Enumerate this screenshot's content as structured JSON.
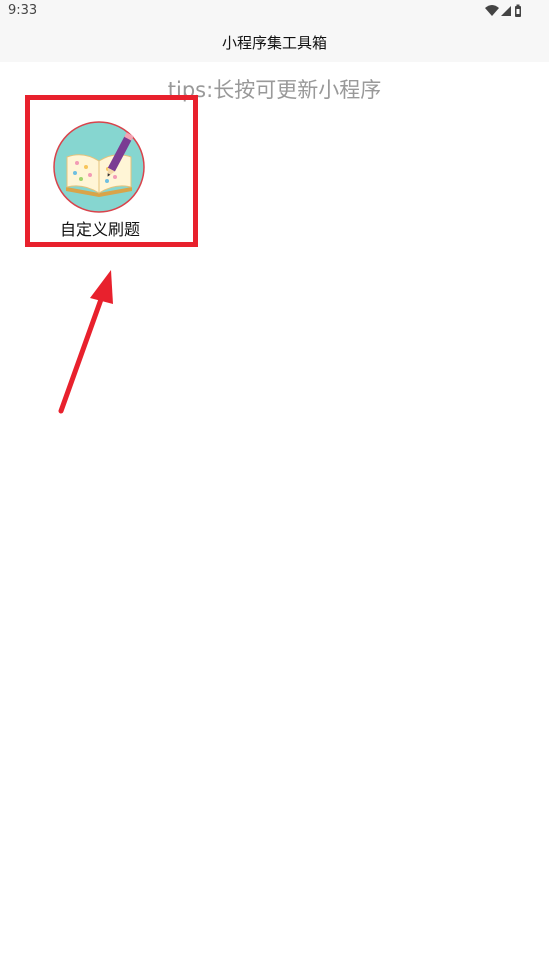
{
  "status_bar": {
    "time": "9:33",
    "icons": [
      "wifi-icon",
      "signal-icon",
      "battery-icon"
    ]
  },
  "header": {
    "title": "小程序集工具箱"
  },
  "tips": "tips:长按可更新小程序",
  "tools": [
    {
      "label": "自定义刷题",
      "icon": "open-book-pencil-icon"
    }
  ],
  "colors": {
    "annotation": "#e8212d",
    "header_bg": "#f7f7f7",
    "tips_text": "#999999",
    "icon_bg": "#86d6d0"
  }
}
